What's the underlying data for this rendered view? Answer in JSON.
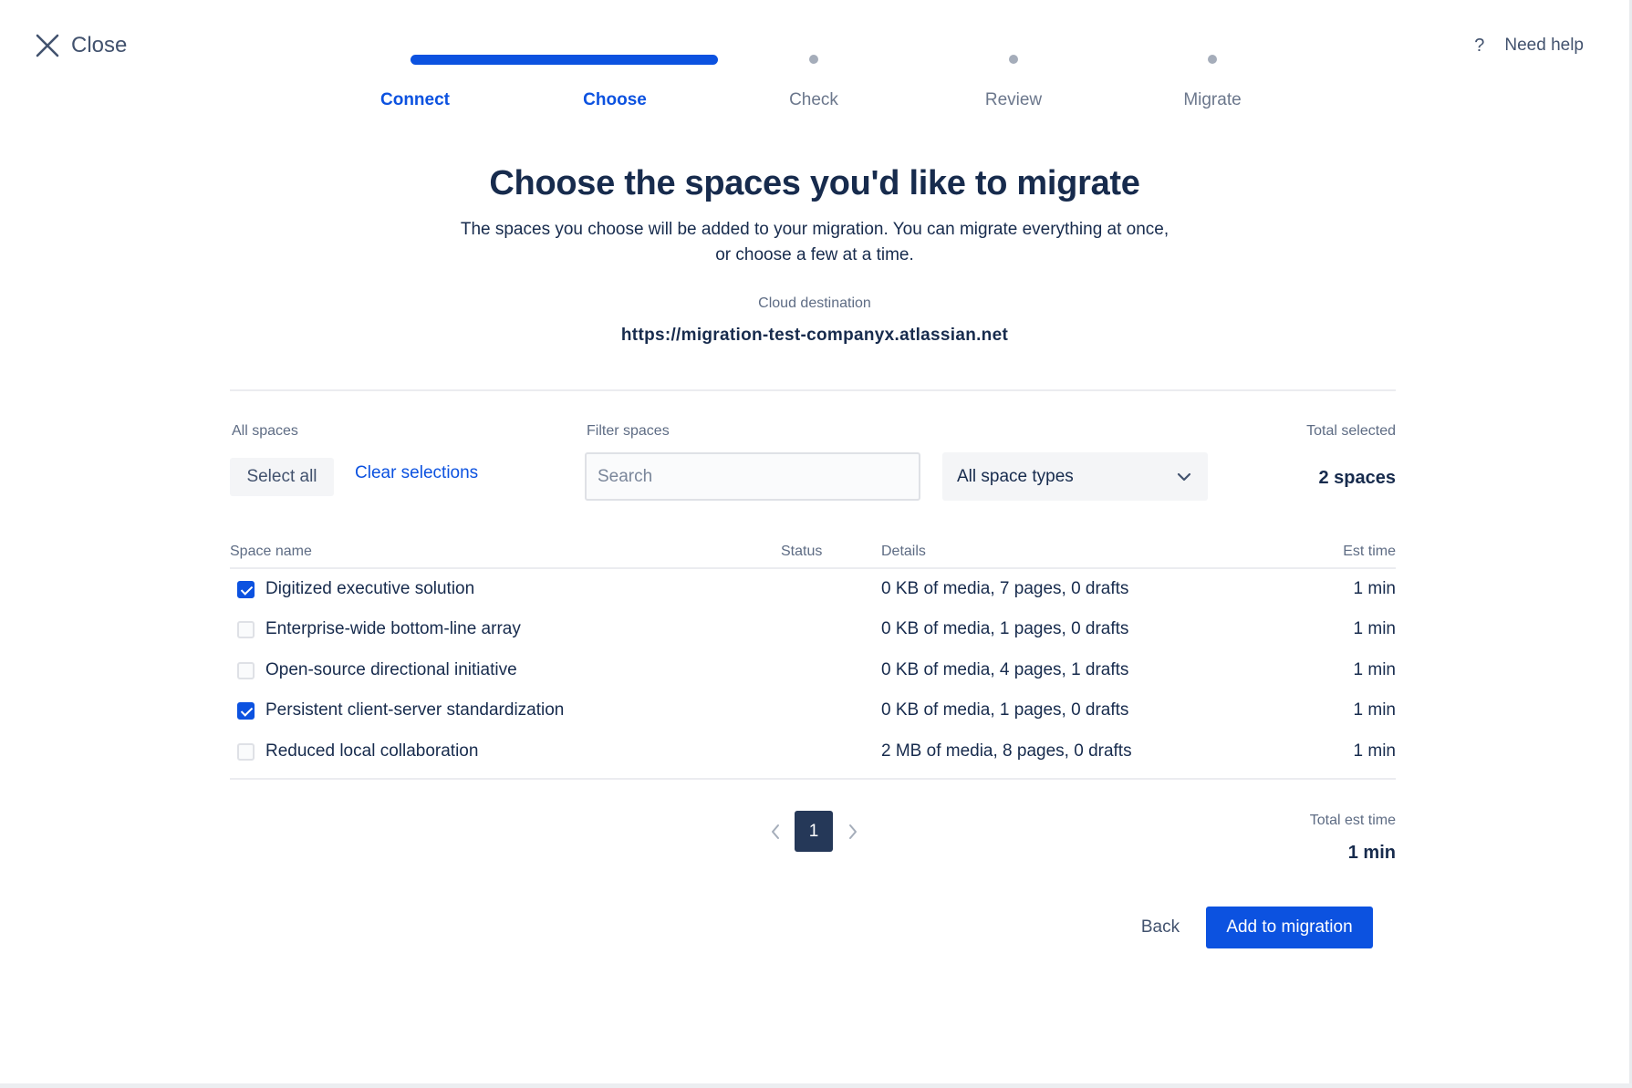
{
  "header": {
    "close_label": "Close",
    "help_icon_glyph": "?",
    "help_label": "Need help"
  },
  "stepper": {
    "progress_fraction": 0.4,
    "steps": [
      {
        "label": "Connect",
        "state": "complete"
      },
      {
        "label": "Choose",
        "state": "current"
      },
      {
        "label": "Check",
        "state": "upcoming"
      },
      {
        "label": "Review",
        "state": "upcoming"
      },
      {
        "label": "Migrate",
        "state": "upcoming"
      }
    ]
  },
  "main": {
    "title": "Choose the spaces you'd like to migrate",
    "subtitle_line1": "The spaces you choose will be added to your migration. You can migrate everything at once,",
    "subtitle_line2": "or choose a few at a time.",
    "destination_label": "Cloud destination",
    "destination_url": "https://migration-test-companyx.atlassian.net"
  },
  "controls": {
    "all_spaces_label": "All spaces",
    "select_all_label": "Select all",
    "clear_selections_label": "Clear selections",
    "filter_label": "Filter spaces",
    "search_placeholder": "Search",
    "space_type_selected": "All space types",
    "total_selected_label": "Total selected",
    "total_selected_value": "2 spaces"
  },
  "table": {
    "headers": {
      "name": "Space name",
      "status": "Status",
      "details": "Details",
      "time": "Est time"
    },
    "rows": [
      {
        "checked": true,
        "name": "Digitized executive solution",
        "details": "0 KB of media, 7 pages, 0 drafts",
        "time": "1 min"
      },
      {
        "checked": false,
        "name": "Enterprise-wide bottom-line array",
        "details": "0 KB of media, 1 pages, 0 drafts",
        "time": "1 min"
      },
      {
        "checked": false,
        "name": "Open-source directional initiative",
        "details": "0 KB of media, 4 pages, 1 drafts",
        "time": "1 min"
      },
      {
        "checked": true,
        "name": "Persistent client-server standardization",
        "details": "0 KB of media, 1 pages, 0 drafts",
        "time": "1 min"
      },
      {
        "checked": false,
        "name": "Reduced local collaboration",
        "details": "2 MB of media, 8 pages, 0 drafts",
        "time": "1 min"
      }
    ]
  },
  "pagination": {
    "current_page": "1"
  },
  "summary": {
    "total_est_label": "Total est time",
    "total_est_value": "1 min"
  },
  "footer": {
    "back_label": "Back",
    "add_label": "Add to migration"
  },
  "colors": {
    "accent": "#0c52e0",
    "text": "#172b4d",
    "muted": "#5e6c84",
    "page_button": "#253858"
  }
}
